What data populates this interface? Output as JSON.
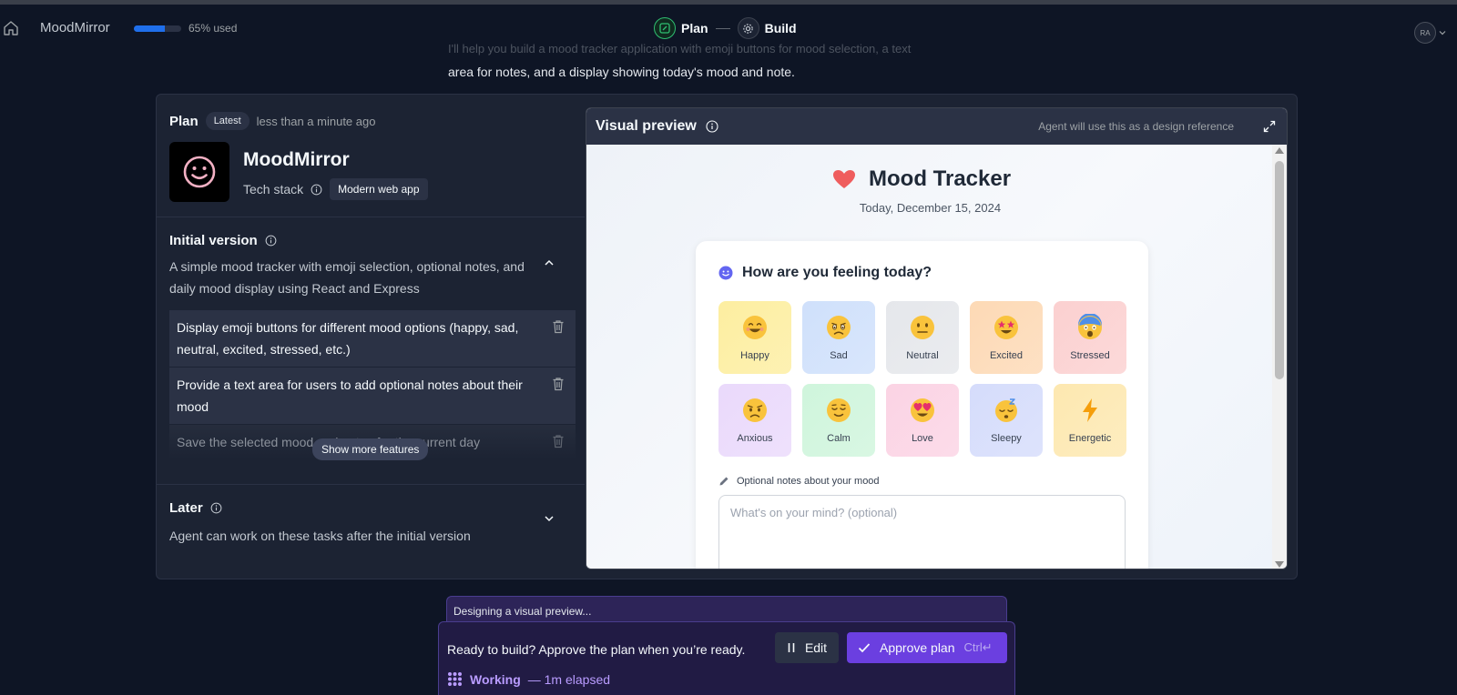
{
  "topbar": {
    "app_name": "MoodMirror",
    "usage_percent": 65,
    "usage_text": "65% used",
    "steps": [
      {
        "label": "Plan",
        "icon": "edit-square-icon",
        "active": true
      },
      {
        "label": "Build",
        "icon": "gear-icon",
        "active": false
      }
    ],
    "avatar_initials": "RA"
  },
  "chat": {
    "faded_line": "I'll help you build a mood tracker application with emoji buttons for mood selection, a text",
    "message": "area for notes, and a display showing today's mood and note."
  },
  "plan": {
    "title": "Plan",
    "badge": "Latest",
    "time": "less than a minute ago",
    "app_title": "MoodMirror",
    "tech_stack_label": "Tech stack",
    "tech_stack_value": "Modern web app",
    "initial_version": {
      "title": "Initial version",
      "description": "A simple mood tracker with emoji selection, optional notes, and daily mood display using React and Express",
      "features": [
        "Display emoji buttons for different mood options (happy, sad, neutral, excited, stressed, etc.)",
        "Provide a text area for users to add optional notes about their mood",
        "Save the selected mood and notes for the current day"
      ],
      "show_more": "Show more features"
    },
    "later": {
      "title": "Later",
      "description": "Agent can work on these tasks after the initial version"
    }
  },
  "visual_preview": {
    "title": "Visual preview",
    "reference_note": "Agent will use this as a design reference",
    "app": {
      "heading": "Mood Tracker",
      "date": "Today, December 15, 2024",
      "question": "How are you feeling today?",
      "moods": [
        {
          "label": "Happy",
          "color": "#fdeea0"
        },
        {
          "label": "Sad",
          "color": "#cfe0fb"
        },
        {
          "label": "Neutral",
          "color": "#e5e7eb"
        },
        {
          "label": "Excited",
          "color": "#fdd9b5"
        },
        {
          "label": "Stressed",
          "color": "#fbd0d0"
        },
        {
          "label": "Anxious",
          "color": "#ead9fb"
        },
        {
          "label": "Calm",
          "color": "#cff5dc"
        },
        {
          "label": "Love",
          "color": "#fbd3e4"
        },
        {
          "label": "Sleepy",
          "color": "#d5dcfb"
        },
        {
          "label": "Energetic",
          "color": "#fde8b0"
        }
      ],
      "notes_label": "Optional notes about your mood",
      "notes_placeholder": "What's on your mind? (optional)"
    }
  },
  "bottom": {
    "status": "Designing a visual preview...",
    "ready_text": "Ready to build? Approve the plan when you’re ready.",
    "edit_label": "Edit",
    "approve_label": "Approve plan",
    "approve_shortcut": "Ctrl↵",
    "working_label": "Working",
    "working_elapsed": "— 1m elapsed"
  },
  "colors": {
    "background": "#0e1525",
    "card": "#1c2333",
    "accent_purple": "#6b3fe0",
    "plan_green": "#2fbf71",
    "usage_blue": "#1f6feb"
  }
}
